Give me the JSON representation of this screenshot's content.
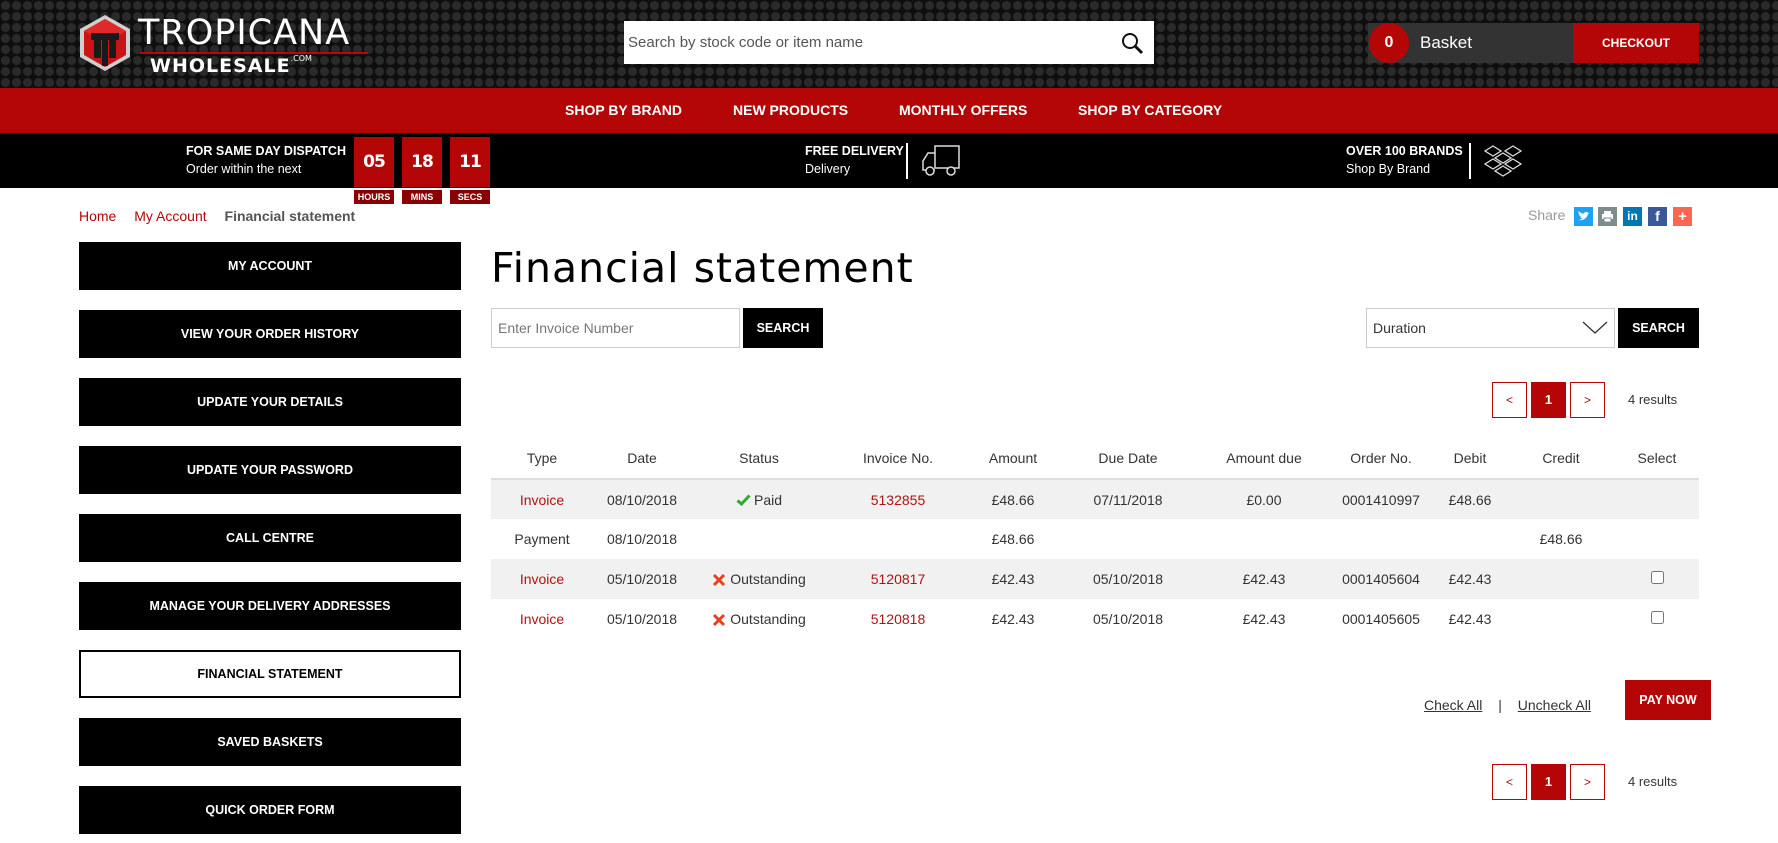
{
  "header": {
    "logo_top": "TROPICANA",
    "logo_bottom": "WHOLESALE",
    "logo_suffix": ".COM",
    "search_placeholder": "Search by stock code or item name",
    "basket_count": "0",
    "basket_label": "Basket",
    "checkout_label": "CHECKOUT"
  },
  "nav": {
    "items": [
      {
        "label": "SHOP BY BRAND"
      },
      {
        "label": "NEW PRODUCTS"
      },
      {
        "label": "MONTHLY OFFERS"
      },
      {
        "label": "SHOP BY CATEGORY"
      }
    ]
  },
  "info_bar": {
    "dispatch_title": "FOR SAME DAY DISPATCH",
    "dispatch_sub": "Order within the next",
    "timer": {
      "hours": "05",
      "hours_label": "HOURS",
      "mins": "18",
      "mins_label": "MINS",
      "secs": "11",
      "secs_label": "SECS"
    },
    "delivery_title": "FREE DELIVERY",
    "delivery_sub": "Delivery",
    "brands_title": "OVER 100 BRANDS",
    "brands_sub": "Shop By Brand"
  },
  "breadcrumb": {
    "items": [
      "Home",
      "My Account"
    ],
    "current": "Financial statement"
  },
  "share": {
    "label": "Share",
    "buttons": [
      {
        "name": "twitter",
        "color": "#1da1f2"
      },
      {
        "name": "print",
        "color": "#7f8c8d"
      },
      {
        "name": "linkedin",
        "color": "#0077b5"
      },
      {
        "name": "facebook",
        "color": "#3b5998"
      },
      {
        "name": "more",
        "color": "#ff6550"
      }
    ]
  },
  "sidebar": {
    "items": [
      {
        "label": "MY ACCOUNT",
        "active": false
      },
      {
        "label": "VIEW YOUR ORDER HISTORY",
        "active": false
      },
      {
        "label": "UPDATE YOUR DETAILS",
        "active": false
      },
      {
        "label": "UPDATE YOUR PASSWORD",
        "active": false
      },
      {
        "label": "CALL CENTRE",
        "active": false
      },
      {
        "label": "MANAGE YOUR DELIVERY ADDRESSES",
        "active": false
      },
      {
        "label": "FINANCIAL STATEMENT",
        "active": true
      },
      {
        "label": "SAVED BASKETS",
        "active": false
      },
      {
        "label": "QUICK ORDER FORM",
        "active": false
      }
    ]
  },
  "main": {
    "title": "Financial statement",
    "invoice_search": {
      "placeholder": "Enter Invoice Number",
      "value": "",
      "button": "SEARCH"
    },
    "duration": {
      "selected": "Duration",
      "button": "SEARCH"
    },
    "pagination": {
      "prev": "<",
      "current": "1",
      "next": ">",
      "results": "4 results"
    },
    "table": {
      "columns": [
        "Type",
        "Date",
        "Status",
        "Invoice No.",
        "Amount",
        "Due Date",
        "Amount due",
        "Order No.",
        "Debit",
        "Credit",
        "Select"
      ],
      "rows": [
        {
          "type": "Invoice",
          "date": "08/10/2018",
          "status": "Paid",
          "status_kind": "paid",
          "invoice_no": "5132855",
          "amount": "£48.66",
          "due_date": "07/11/2018",
          "amount_due": "£0.00",
          "order_no": "0001410997",
          "debit": "£48.66",
          "credit": "",
          "selectable": false,
          "checked": false
        },
        {
          "type": "Payment",
          "date": "08/10/2018",
          "status": "",
          "status_kind": "",
          "invoice_no": "",
          "amount": "£48.66",
          "due_date": "",
          "amount_due": "",
          "order_no": "",
          "debit": "",
          "credit": "£48.66",
          "selectable": false,
          "checked": false
        },
        {
          "type": "Invoice",
          "date": "05/10/2018",
          "status": "Outstanding",
          "status_kind": "outstanding",
          "invoice_no": "5120817",
          "amount": "£42.43",
          "due_date": "05/10/2018",
          "amount_due": "£42.43",
          "order_no": "0001405604",
          "debit": "£42.43",
          "credit": "",
          "selectable": true,
          "checked": false
        },
        {
          "type": "Invoice",
          "date": "05/10/2018",
          "status": "Outstanding",
          "status_kind": "outstanding",
          "invoice_no": "5120818",
          "amount": "£42.43",
          "due_date": "05/10/2018",
          "amount_due": "£42.43",
          "order_no": "0001405605",
          "debit": "£42.43",
          "credit": "",
          "selectable": true,
          "checked": false
        }
      ]
    },
    "check_all": "Check All",
    "separator": "|",
    "uncheck_all": "Uncheck All",
    "pay_now": "PAY NOW"
  },
  "colors": {
    "brand_red": "#b40606",
    "link_red": "#b01313",
    "paid_green": "#1a8a1a",
    "outstanding_orange": "#e8401c"
  }
}
